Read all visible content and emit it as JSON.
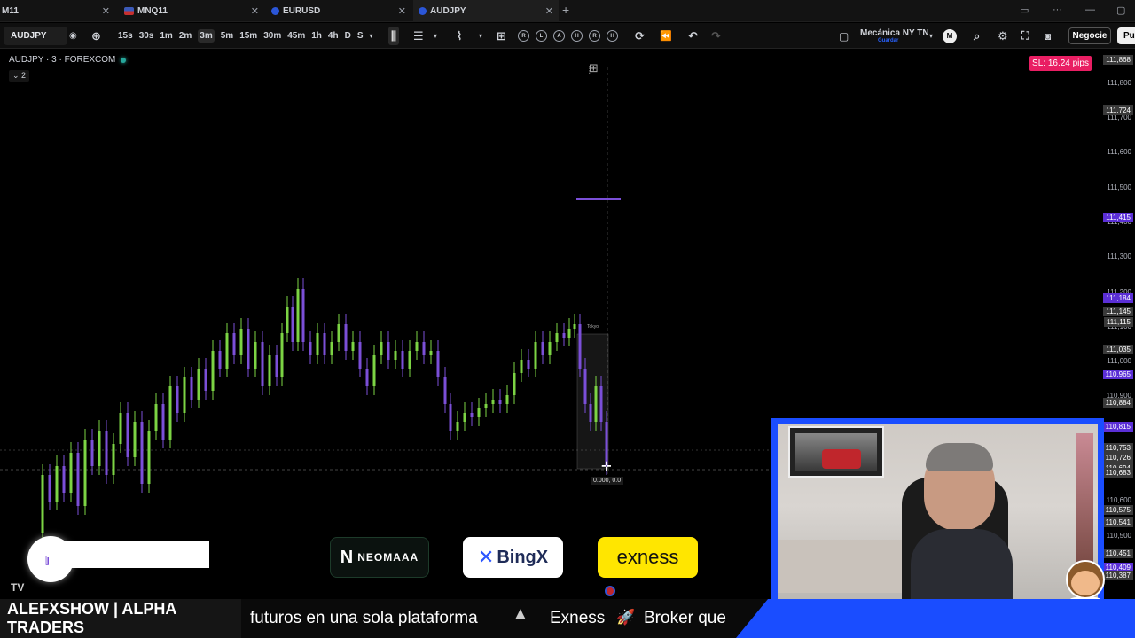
{
  "tabs": [
    {
      "label": "M11",
      "flag": ""
    },
    {
      "label": "MNQ11",
      "flag": "us"
    },
    {
      "label": "EURUSD",
      "flag": "eu"
    },
    {
      "label": "AUDJPY",
      "flag": "au",
      "active": true
    }
  ],
  "toolbar": {
    "symbol": "AUDJPY",
    "intervals": [
      "15s",
      "30s",
      "1m",
      "2m",
      "3m",
      "5m",
      "15m",
      "30m",
      "45m",
      "1h",
      "4h",
      "D",
      "S"
    ],
    "active_interval": "3m",
    "replay_letters": [
      "R",
      "L",
      "A",
      "H",
      "R",
      "H"
    ],
    "layout_name": "Mecánica NY TN",
    "layout_sub": "Guardar",
    "user_initial": "M",
    "trade_label": "Negocie",
    "publish_label": "Pu"
  },
  "legend": {
    "title": "AUDJPY · 3 · FOREXCOM",
    "collapse": "2"
  },
  "sl_badge": "SL: 16.24 pips",
  "cursor_label": "0.000, 0.0",
  "box_label": "Tokyo",
  "price_scale": {
    "plain": [
      "111,868",
      "111,800",
      "111,700",
      "111,600",
      "111,500",
      "111,400",
      "111,300",
      "111,200",
      "111,100",
      "111,000",
      "110,900",
      "110,600",
      "110,500",
      "110,400",
      "110,300"
    ],
    "tags": [
      {
        "value": "111,868",
        "color": "#3a3a3a"
      },
      {
        "value": "111,724",
        "color": "#3a3a3a"
      },
      {
        "value": "111,415",
        "color": "#5b2fd6"
      },
      {
        "value": "111,184",
        "color": "#5b2fd6"
      },
      {
        "value": "111,145",
        "color": "#3a3a3a"
      },
      {
        "value": "111,115",
        "color": "#3a3a3a"
      },
      {
        "value": "111,035",
        "color": "#3a3a3a"
      },
      {
        "value": "110,965",
        "color": "#5b2fd6"
      },
      {
        "value": "110,884",
        "color": "#3a3a3a"
      },
      {
        "value": "110,815",
        "color": "#5b2fd6"
      },
      {
        "value": "110,753",
        "color": "#3a3a3a"
      },
      {
        "value": "110,726",
        "color": "#3a3a3a"
      },
      {
        "value": "110,694",
        "color": "#3a3a3a"
      },
      {
        "value": "110,683",
        "color": "#3a3a3a"
      },
      {
        "value": "110,575",
        "color": "#3a3a3a"
      },
      {
        "value": "110,541",
        "color": "#3a3a3a"
      },
      {
        "value": "110,451",
        "color": "#3a3a3a"
      },
      {
        "value": "110,409",
        "color": "#5b2fd6"
      },
      {
        "value": "110,387",
        "color": "#3a3a3a"
      }
    ]
  },
  "sponsors": {
    "neomaaa": "NEOMAAA",
    "bingx": "BingX",
    "exness": "exness"
  },
  "ticker": {
    "brand": "ALEFXSHOW | ALPHA TRADERS",
    "text1": "futuros en una sola plataforma",
    "text2": "Exness",
    "text3": "Broker que"
  },
  "colors": {
    "bull": "#7cd444",
    "bear": "#7b4fd8",
    "accent": "#2962ff",
    "sl": "#e91e63"
  }
}
